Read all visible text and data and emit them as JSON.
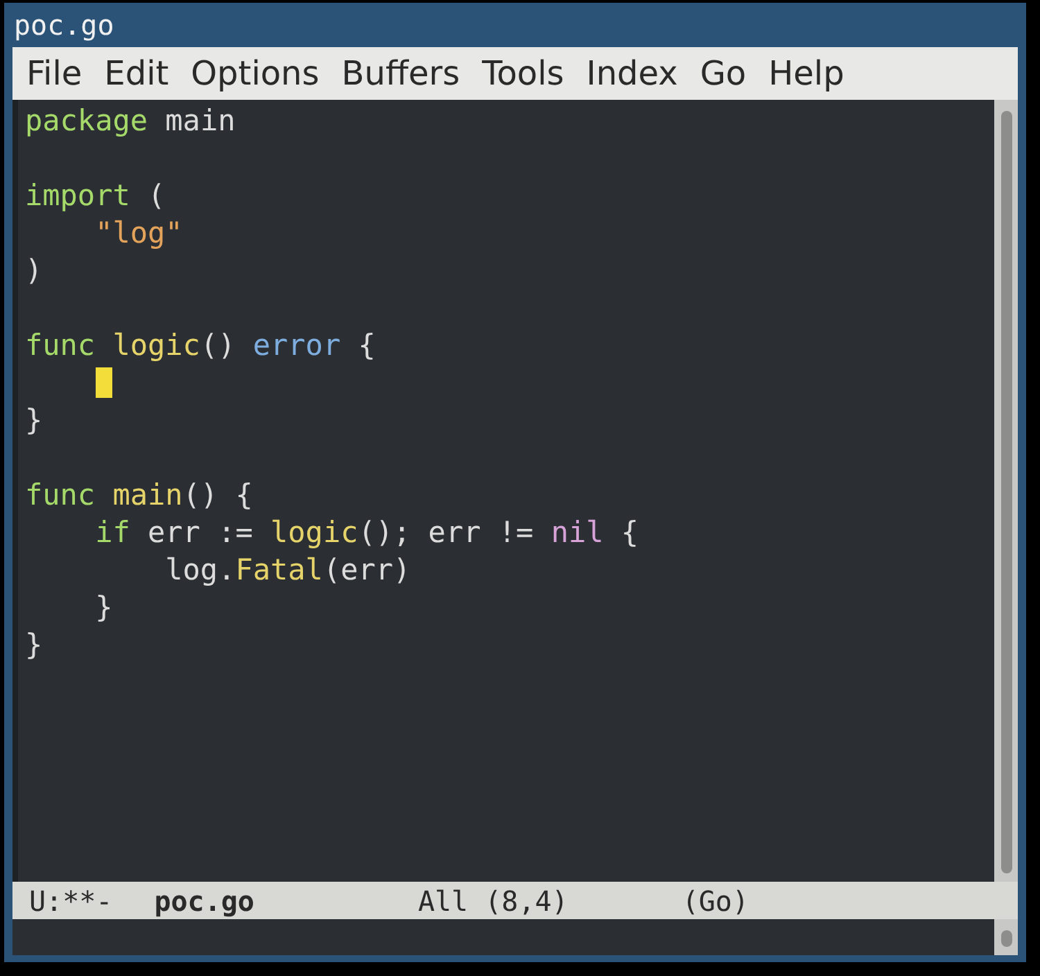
{
  "window": {
    "title": "poc.go"
  },
  "menu": [
    "File",
    "Edit",
    "Options",
    "Buffers",
    "Tools",
    "Index",
    "Go",
    "Help"
  ],
  "code": [
    [
      {
        "kind": "keyword",
        "text": "package "
      },
      {
        "kind": "plain",
        "text": "main"
      }
    ],
    {
      "blank": true
    },
    [
      {
        "kind": "keyword",
        "text": "import"
      },
      {
        "kind": "plain",
        "text": " ("
      }
    ],
    [
      {
        "kind": "string",
        "text": "    \"log\""
      }
    ],
    [
      {
        "kind": "plain",
        "text": ")"
      }
    ],
    {
      "blank": true
    },
    [
      {
        "kind": "keyword",
        "text": "func "
      },
      {
        "kind": "function",
        "text": "logic"
      },
      {
        "kind": "plain",
        "text": "() "
      },
      {
        "kind": "type",
        "text": "error"
      },
      {
        "kind": "plain",
        "text": " {"
      }
    ],
    {
      "blank": true,
      "cursor": true
    },
    [
      {
        "kind": "plain",
        "text": "}"
      }
    ],
    {
      "blank": true
    },
    [
      {
        "kind": "keyword",
        "text": "func "
      },
      {
        "kind": "function",
        "text": "main"
      },
      {
        "kind": "plain",
        "text": "() {"
      }
    ],
    [
      {
        "kind": "keyword",
        "text": "    if"
      },
      {
        "kind": "plain",
        "text": " err := "
      },
      {
        "kind": "function",
        "text": "logic"
      },
      {
        "kind": "plain",
        "text": "(); err != "
      },
      {
        "kind": "constant",
        "text": "nil"
      },
      {
        "kind": "plain",
        "text": " {"
      }
    ],
    [
      {
        "kind": "plain",
        "text": "        log."
      },
      {
        "kind": "function",
        "text": "Fatal"
      },
      {
        "kind": "plain",
        "text": "(err)"
      }
    ],
    [
      {
        "kind": "plain",
        "text": "    }"
      }
    ],
    [
      {
        "kind": "plain",
        "text": "}"
      }
    ]
  ],
  "mode_line": {
    "status": "U:**-",
    "buffer": "poc.go",
    "position": "All (8,4)",
    "mode": "(Go)"
  }
}
